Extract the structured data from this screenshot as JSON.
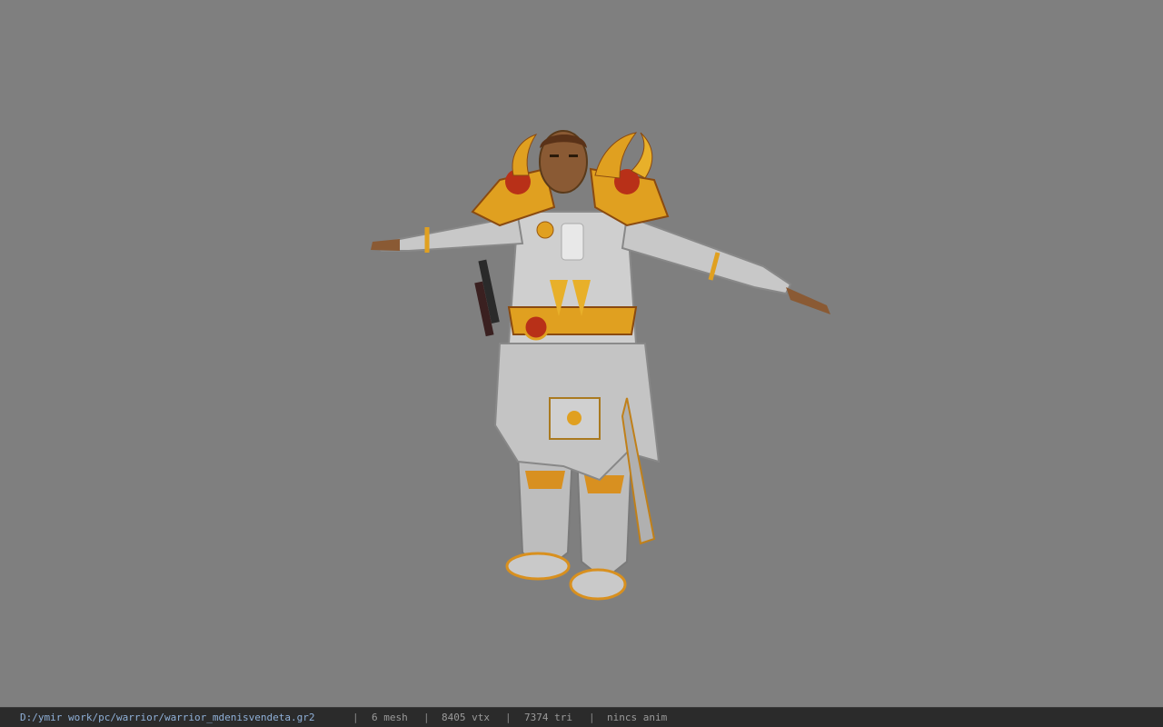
{
  "status": {
    "file_path": "D:/ymir work/pc/warrior/warrior_mdenisvendeta.gr2",
    "separator": "|",
    "mesh": "6 mesh",
    "vertices": "8405 vtx",
    "triangles": "7374 tri",
    "animation": "nincs anim"
  },
  "colors": {
    "background": "#7f7f7f",
    "statusbar": "#2b2b2b",
    "armor_silver": "#c8c8c8",
    "armor_gold": "#e0a020",
    "armor_red": "#b83018",
    "skin": "#8a5a34"
  }
}
